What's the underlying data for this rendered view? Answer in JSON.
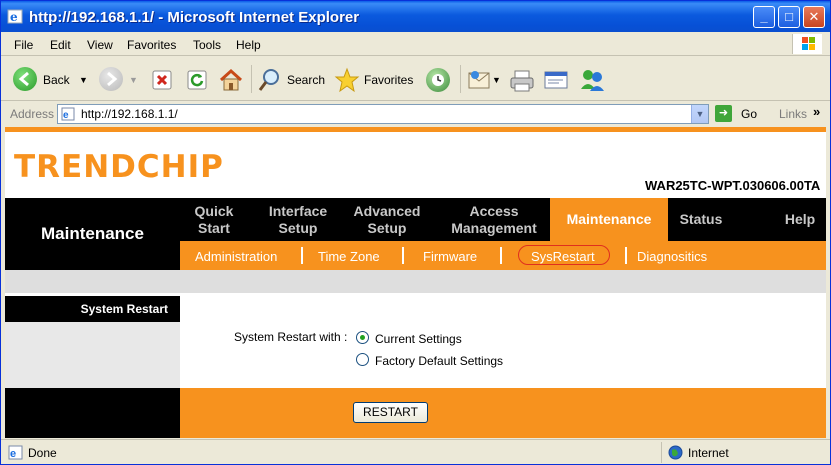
{
  "window": {
    "title": "http://192.168.1.1/ - Microsoft Internet Explorer",
    "buttons": {
      "minimize": "_",
      "maximize": "□",
      "close": "✕"
    }
  },
  "menu": [
    "File",
    "Edit",
    "View",
    "Favorites",
    "Tools",
    "Help"
  ],
  "toolbar": {
    "back_label": "Back",
    "search_label": "Search",
    "favorites_label": "Favorites"
  },
  "address": {
    "label": "Address",
    "url": "http://192.168.1.1/",
    "go_label": "Go",
    "links_label": "Links"
  },
  "page": {
    "brand": "TRENDCHIP",
    "model": "WAR25TC-WPT.030606.00TA",
    "section_title": "Maintenance",
    "tabs": [
      {
        "line1": "Quick",
        "line2": "Start"
      },
      {
        "line1": "Interface",
        "line2": "Setup"
      },
      {
        "line1": "Advanced",
        "line2": "Setup"
      },
      {
        "line1": "Access",
        "line2": "Management"
      },
      {
        "line1": "Maintenance",
        "line2": ""
      },
      {
        "line1": "Status",
        "line2": ""
      },
      {
        "line1": "Help",
        "line2": ""
      }
    ],
    "subnav": [
      "Administration",
      "Time Zone",
      "Firmware",
      "SysRestart",
      "Diagnositics"
    ],
    "left_label": "System Restart",
    "restart_with_label": "System Restart with :",
    "options": [
      {
        "label": "Current Settings",
        "checked": true
      },
      {
        "label": "Factory Default Settings",
        "checked": false
      }
    ],
    "restart_button": "RESTART"
  },
  "status": {
    "text": "Done",
    "zone": "Internet"
  },
  "colors": {
    "accent": "#f7921e",
    "titlebar": "#0a5ce8"
  }
}
